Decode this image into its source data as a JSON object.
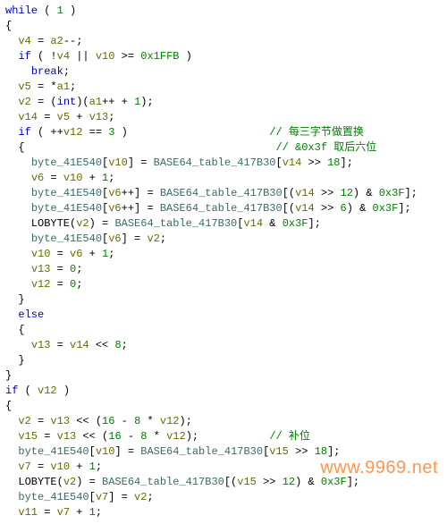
{
  "lines": [
    [
      [
        "kw",
        "while"
      ],
      [
        "plain",
        " ( "
      ],
      [
        "num",
        "1"
      ],
      [
        "plain",
        " )"
      ]
    ],
    [
      [
        "plain",
        "{"
      ]
    ],
    [
      [
        "plain",
        "  "
      ],
      [
        "var",
        "v4"
      ],
      [
        "plain",
        " = "
      ],
      [
        "var",
        "a2"
      ],
      [
        "plain",
        "--;"
      ]
    ],
    [
      [
        "plain",
        "  "
      ],
      [
        "kw",
        "if"
      ],
      [
        "plain",
        " ( !"
      ],
      [
        "var",
        "v4"
      ],
      [
        "plain",
        " || "
      ],
      [
        "var",
        "v10"
      ],
      [
        "plain",
        " >= "
      ],
      [
        "num",
        "0x1FFB"
      ],
      [
        "plain",
        " )"
      ]
    ],
    [
      [
        "plain",
        "    "
      ],
      [
        "kw",
        "break"
      ],
      [
        "plain",
        ";"
      ]
    ],
    [
      [
        "plain",
        "  "
      ],
      [
        "var",
        "v5"
      ],
      [
        "plain",
        " = *"
      ],
      [
        "var",
        "a1"
      ],
      [
        "plain",
        ";"
      ]
    ],
    [
      [
        "plain",
        "  "
      ],
      [
        "var",
        "v2"
      ],
      [
        "plain",
        " = ("
      ],
      [
        "kw",
        "int"
      ],
      [
        "plain",
        ")("
      ],
      [
        "var",
        "a1"
      ],
      [
        "plain",
        "++ + "
      ],
      [
        "num",
        "1"
      ],
      [
        "plain",
        ");"
      ]
    ],
    [
      [
        "plain",
        "  "
      ],
      [
        "var",
        "v14"
      ],
      [
        "plain",
        " = "
      ],
      [
        "var",
        "v5"
      ],
      [
        "plain",
        " + "
      ],
      [
        "var",
        "v13"
      ],
      [
        "plain",
        ";"
      ]
    ],
    [
      [
        "plain",
        "  "
      ],
      [
        "kw",
        "if"
      ],
      [
        "plain",
        " ( ++"
      ],
      [
        "var",
        "v12"
      ],
      [
        "plain",
        " == "
      ],
      [
        "num",
        "3"
      ],
      [
        "plain",
        " )                      "
      ],
      [
        "cm",
        "// 每三字节做置换"
      ]
    ],
    [
      [
        "plain",
        "  {                                       "
      ],
      [
        "cm",
        "// &0x3f 取后六位"
      ]
    ],
    [
      [
        "plain",
        "    "
      ],
      [
        "gbl",
        "byte_41E540"
      ],
      [
        "plain",
        "["
      ],
      [
        "var",
        "v10"
      ],
      [
        "plain",
        "] = "
      ],
      [
        "gbl",
        "BASE64_table_417B30"
      ],
      [
        "plain",
        "["
      ],
      [
        "var",
        "v14"
      ],
      [
        "plain",
        " >> "
      ],
      [
        "num",
        "18"
      ],
      [
        "plain",
        "];"
      ]
    ],
    [
      [
        "plain",
        "    "
      ],
      [
        "var",
        "v6"
      ],
      [
        "plain",
        " = "
      ],
      [
        "var",
        "v10"
      ],
      [
        "plain",
        " + "
      ],
      [
        "num",
        "1"
      ],
      [
        "plain",
        ";"
      ]
    ],
    [
      [
        "plain",
        "    "
      ],
      [
        "gbl",
        "byte_41E540"
      ],
      [
        "plain",
        "["
      ],
      [
        "var",
        "v6"
      ],
      [
        "plain",
        "++] = "
      ],
      [
        "gbl",
        "BASE64_table_417B30"
      ],
      [
        "plain",
        "[("
      ],
      [
        "var",
        "v14"
      ],
      [
        "plain",
        " >> "
      ],
      [
        "num",
        "12"
      ],
      [
        "plain",
        ") & "
      ],
      [
        "num",
        "0x3F"
      ],
      [
        "plain",
        "];"
      ]
    ],
    [
      [
        "plain",
        "    "
      ],
      [
        "gbl",
        "byte_41E540"
      ],
      [
        "plain",
        "["
      ],
      [
        "var",
        "v6"
      ],
      [
        "plain",
        "++] = "
      ],
      [
        "gbl",
        "BASE64_table_417B30"
      ],
      [
        "plain",
        "[("
      ],
      [
        "var",
        "v14"
      ],
      [
        "plain",
        " >> "
      ],
      [
        "num",
        "6"
      ],
      [
        "plain",
        ") & "
      ],
      [
        "num",
        "0x3F"
      ],
      [
        "plain",
        "];"
      ]
    ],
    [
      [
        "plain",
        "    LOBYTE("
      ],
      [
        "var",
        "v2"
      ],
      [
        "plain",
        ") = "
      ],
      [
        "gbl",
        "BASE64_table_417B30"
      ],
      [
        "plain",
        "["
      ],
      [
        "var",
        "v14"
      ],
      [
        "plain",
        " & "
      ],
      [
        "num",
        "0x3F"
      ],
      [
        "plain",
        "];"
      ]
    ],
    [
      [
        "plain",
        "    "
      ],
      [
        "gbl",
        "byte_41E540"
      ],
      [
        "plain",
        "["
      ],
      [
        "var",
        "v6"
      ],
      [
        "plain",
        "] = "
      ],
      [
        "var",
        "v2"
      ],
      [
        "plain",
        ";"
      ]
    ],
    [
      [
        "plain",
        "    "
      ],
      [
        "var",
        "v10"
      ],
      [
        "plain",
        " = "
      ],
      [
        "var",
        "v6"
      ],
      [
        "plain",
        " + "
      ],
      [
        "num",
        "1"
      ],
      [
        "plain",
        ";"
      ]
    ],
    [
      [
        "plain",
        "    "
      ],
      [
        "var",
        "v13"
      ],
      [
        "plain",
        " = "
      ],
      [
        "num",
        "0"
      ],
      [
        "plain",
        ";"
      ]
    ],
    [
      [
        "plain",
        "    "
      ],
      [
        "var",
        "v12"
      ],
      [
        "plain",
        " = "
      ],
      [
        "num",
        "0"
      ],
      [
        "plain",
        ";"
      ]
    ],
    [
      [
        "plain",
        "  }"
      ]
    ],
    [
      [
        "plain",
        "  "
      ],
      [
        "kw",
        "else"
      ]
    ],
    [
      [
        "plain",
        "  {"
      ]
    ],
    [
      [
        "plain",
        "    "
      ],
      [
        "var",
        "v13"
      ],
      [
        "plain",
        " = "
      ],
      [
        "var",
        "v14"
      ],
      [
        "plain",
        " << "
      ],
      [
        "num",
        "8"
      ],
      [
        "plain",
        ";"
      ]
    ],
    [
      [
        "plain",
        "  }"
      ]
    ],
    [
      [
        "plain",
        "}"
      ]
    ],
    [
      [
        "kw",
        "if"
      ],
      [
        "plain",
        " ( "
      ],
      [
        "var",
        "v12"
      ],
      [
        "plain",
        " )"
      ]
    ],
    [
      [
        "plain",
        "{"
      ]
    ],
    [
      [
        "plain",
        "  "
      ],
      [
        "var",
        "v2"
      ],
      [
        "plain",
        " = "
      ],
      [
        "var",
        "v13"
      ],
      [
        "plain",
        " << ("
      ],
      [
        "num",
        "16"
      ],
      [
        "plain",
        " - "
      ],
      [
        "num",
        "8"
      ],
      [
        "plain",
        " * "
      ],
      [
        "var",
        "v12"
      ],
      [
        "plain",
        ");"
      ]
    ],
    [
      [
        "plain",
        "  "
      ],
      [
        "var",
        "v15"
      ],
      [
        "plain",
        " = "
      ],
      [
        "var",
        "v13"
      ],
      [
        "plain",
        " << ("
      ],
      [
        "num",
        "16"
      ],
      [
        "plain",
        " - "
      ],
      [
        "num",
        "8"
      ],
      [
        "plain",
        " * "
      ],
      [
        "var",
        "v12"
      ],
      [
        "plain",
        ");           "
      ],
      [
        "cm",
        "// 补位"
      ]
    ],
    [
      [
        "plain",
        "  "
      ],
      [
        "gbl",
        "byte_41E540"
      ],
      [
        "plain",
        "["
      ],
      [
        "var",
        "v10"
      ],
      [
        "plain",
        "] = "
      ],
      [
        "gbl",
        "BASE64_table_417B30"
      ],
      [
        "plain",
        "["
      ],
      [
        "var",
        "v15"
      ],
      [
        "plain",
        " >> "
      ],
      [
        "num",
        "18"
      ],
      [
        "plain",
        "];"
      ]
    ],
    [
      [
        "plain",
        "  "
      ],
      [
        "var",
        "v7"
      ],
      [
        "plain",
        " = "
      ],
      [
        "var",
        "v10"
      ],
      [
        "plain",
        " + "
      ],
      [
        "num",
        "1"
      ],
      [
        "plain",
        ";"
      ]
    ],
    [
      [
        "plain",
        "  LOBYTE("
      ],
      [
        "var",
        "v2"
      ],
      [
        "plain",
        ") = "
      ],
      [
        "gbl",
        "BASE64_table_417B30"
      ],
      [
        "plain",
        "[("
      ],
      [
        "var",
        "v15"
      ],
      [
        "plain",
        " >> "
      ],
      [
        "num",
        "12"
      ],
      [
        "plain",
        ") & "
      ],
      [
        "num",
        "0x3F"
      ],
      [
        "plain",
        "];"
      ]
    ],
    [
      [
        "plain",
        "  "
      ],
      [
        "gbl",
        "byte_41E540"
      ],
      [
        "plain",
        "["
      ],
      [
        "var",
        "v7"
      ],
      [
        "plain",
        "] = "
      ],
      [
        "var",
        "v2"
      ],
      [
        "plain",
        ";"
      ]
    ],
    [
      [
        "plain",
        "  "
      ],
      [
        "var",
        "v11"
      ],
      [
        "plain",
        " = "
      ],
      [
        "var",
        "v7"
      ],
      [
        "plain",
        " + "
      ],
      [
        "num",
        "1"
      ],
      [
        "plain",
        ";"
      ]
    ]
  ],
  "watermark": "www.9969.net"
}
